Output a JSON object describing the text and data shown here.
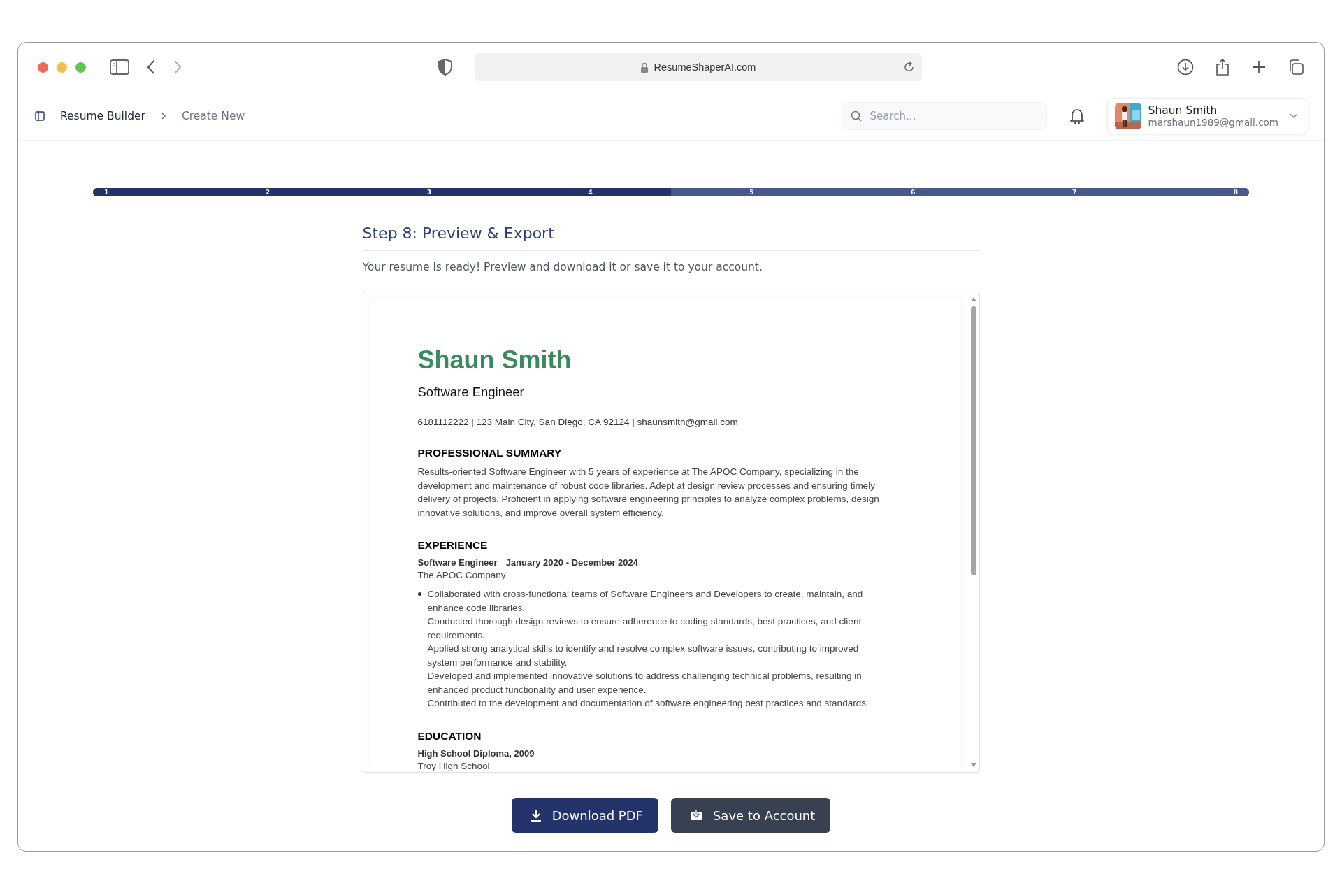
{
  "browser": {
    "url": "ResumeShaperAI.com"
  },
  "nav": {
    "breadcrumbs": [
      "Resume Builder",
      "Create New"
    ],
    "search": {
      "placeholder": "Search..."
    },
    "user": {
      "name": "Shaun Smith",
      "email": "marshaun1989@gmail.com"
    }
  },
  "progress": {
    "steps": [
      {
        "label": "1",
        "completed": true
      },
      {
        "label": "2",
        "completed": true
      },
      {
        "label": "3",
        "completed": true
      },
      {
        "label": "4",
        "completed": true
      },
      {
        "label": "5",
        "completed": false
      },
      {
        "label": "6",
        "completed": false
      },
      {
        "label": "7",
        "completed": false
      },
      {
        "label": "8",
        "completed": false
      }
    ]
  },
  "step": {
    "title": "Step 8: Preview & Export",
    "description": "Your resume is ready! Preview and download it or save it to your account."
  },
  "resume": {
    "name": "Shaun Smith",
    "headline": "Software Engineer",
    "contact": "6181112222 | 123 Main City, San Diego, CA 92124 | shaunsmith@gmail.com",
    "sections": [
      {
        "kind": "summary",
        "heading": "PROFESSIONAL SUMMARY",
        "text": "Results-oriented Software Engineer with 5 years of experience at The APOC Company, specializing in the development and maintenance of robust code libraries. Adept at design review processes and ensuring timely delivery of projects. Proficient in applying software engineering principles to analyze complex problems, design innovative solutions, and improve overall system efficiency."
      },
      {
        "kind": "experience",
        "heading": "EXPERIENCE",
        "role": "Software Engineer",
        "dates": "January 2020 - December 2024",
        "org": "The APOC Company",
        "bullets": [
          {
            "text": "Collaborated with cross-functional teams of Software Engineers and Developers to create, maintain, and enhance code libraries.",
            "bulleted": true
          },
          {
            "text": "Conducted thorough design reviews to ensure adherence to coding standards, best practices, and client requirements.",
            "bulleted": false
          },
          {
            "text": "Applied strong analytical skills to identify and resolve complex software issues, contributing to improved system performance and stability.",
            "bulleted": false
          },
          {
            "text": "Developed and implemented innovative solutions to address challenging technical problems, resulting in enhanced product functionality and user experience.",
            "bulleted": false
          },
          {
            "text": "Contributed to the development and documentation of software engineering best practices and standards.",
            "bulleted": false
          }
        ]
      },
      {
        "kind": "education",
        "heading": "EDUCATION",
        "degree": "High School Diploma, 2009",
        "org": "Troy High School"
      }
    ]
  },
  "actions": [
    {
      "kind": "download",
      "label": "Download PDF"
    },
    {
      "kind": "save",
      "label": "Save to Account"
    }
  ]
}
